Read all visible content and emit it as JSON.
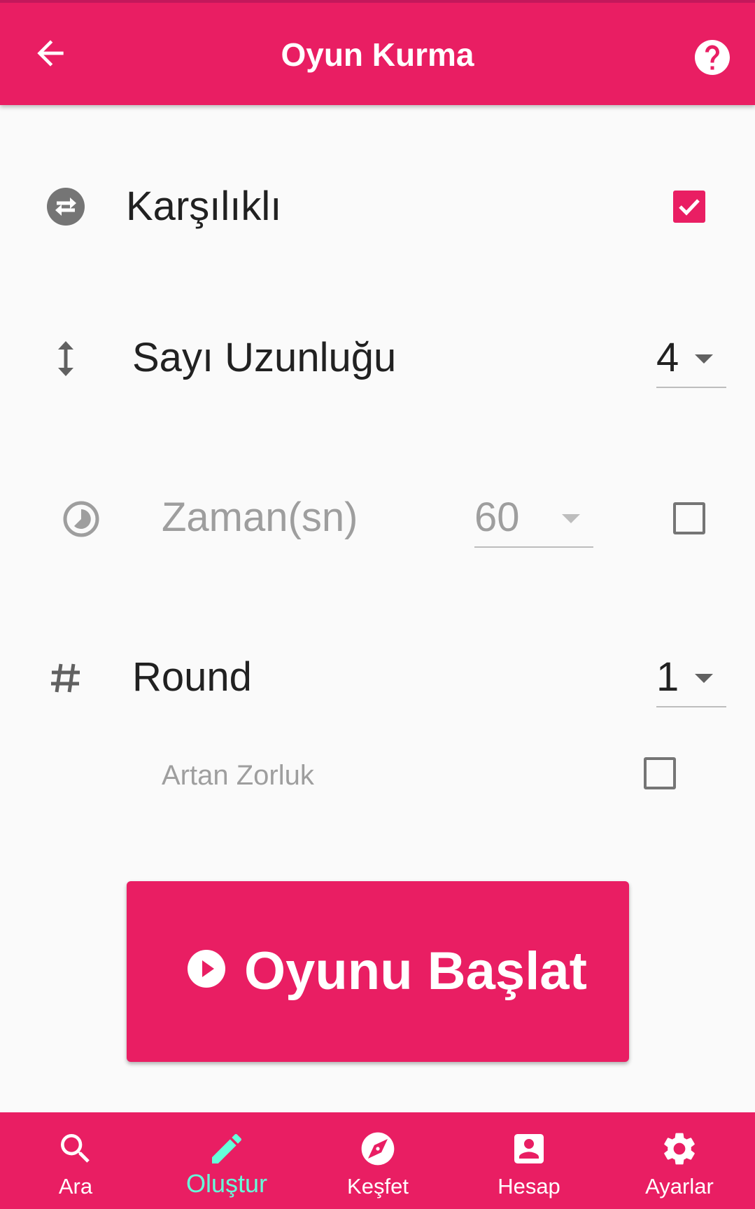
{
  "header": {
    "title": "Oyun Kurma",
    "back_icon": "arrow-back-icon",
    "help_icon": "help-circle-icon"
  },
  "settings": {
    "mutual": {
      "label": "Karşılıklı",
      "checked": true,
      "icon": "swap-horizontal-circle-icon"
    },
    "number_length": {
      "label": "Sayı Uzunluğu",
      "value": "4",
      "icon": "vertical-arrows-icon"
    },
    "time": {
      "label": "Zaman(sn)",
      "value": "60",
      "enabled": false,
      "checked": false,
      "icon": "timelapse-icon"
    },
    "round": {
      "label": "Round",
      "value": "1",
      "icon": "hash-icon"
    },
    "increasing_difficulty": {
      "label": "Artan Zorluk",
      "checked": false
    }
  },
  "start_button": {
    "label": "Oyunu Başlat",
    "icon": "play-circle-icon"
  },
  "bottom_nav": {
    "active": "Oluştur",
    "items": [
      {
        "label": "Ara",
        "icon": "search-icon"
      },
      {
        "label": "Oluştur",
        "icon": "pencil-icon"
      },
      {
        "label": "Keşfet",
        "icon": "compass-icon"
      },
      {
        "label": "Hesap",
        "icon": "account-box-icon"
      },
      {
        "label": "Ayarlar",
        "icon": "gear-icon"
      }
    ]
  },
  "colors": {
    "primary": "#e91e63",
    "accent": "#64ffda",
    "background": "#fafafa"
  }
}
